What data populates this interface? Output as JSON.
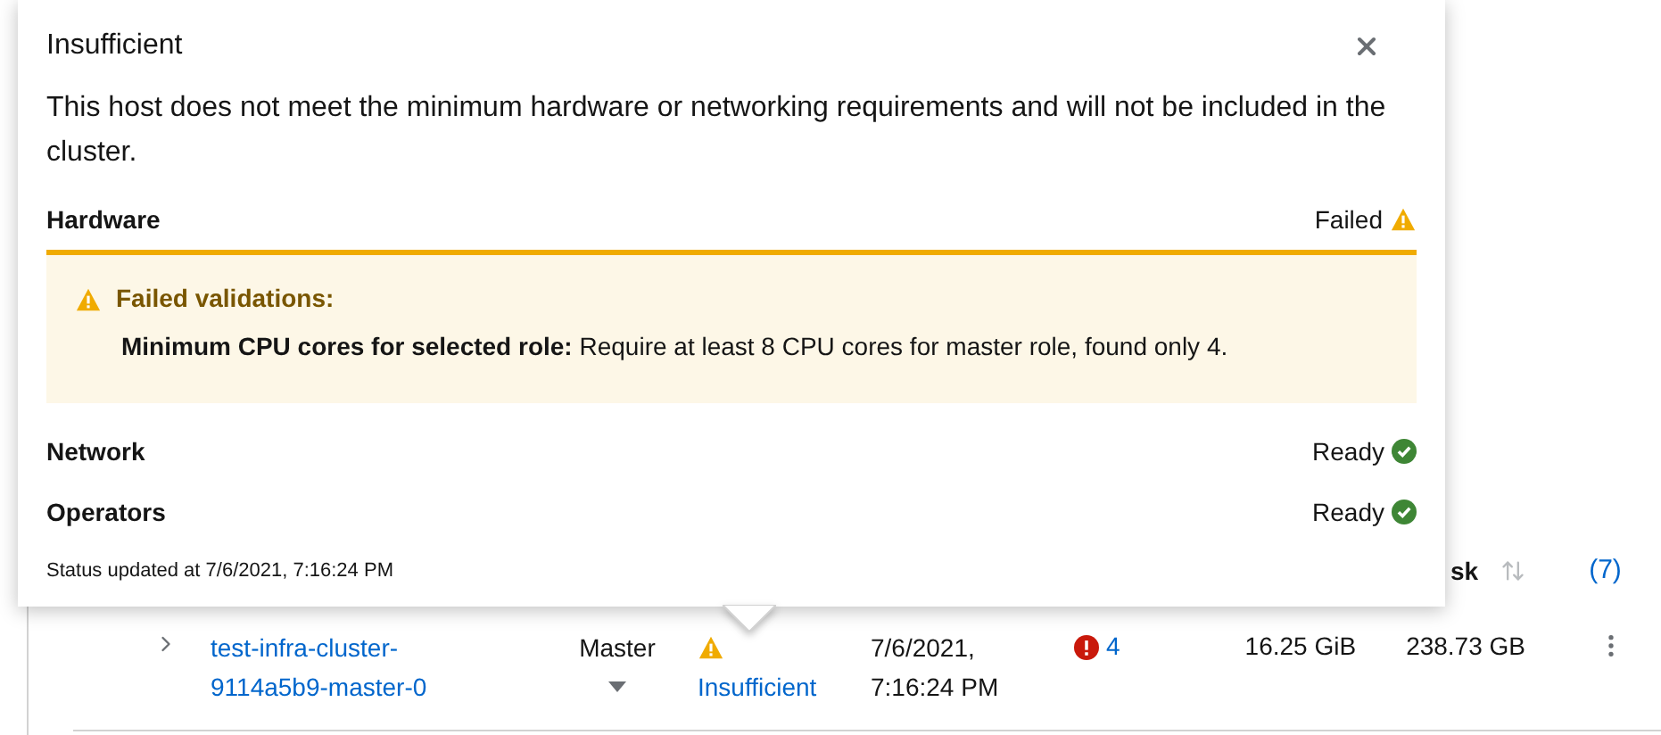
{
  "popover": {
    "title": "Insufficient",
    "description": "This host does not meet the minimum hardware or networking requirements and will not be included in the cluster.",
    "sections": [
      {
        "label": "Hardware",
        "status": "Failed",
        "kind": "failed",
        "alert": {
          "title": "Failed validations:",
          "items": [
            {
              "name": "Minimum CPU cores for selected role:",
              "text": "Require at least 8 CPU cores for master role, found only 4."
            }
          ]
        }
      },
      {
        "label": "Network",
        "status": "Ready",
        "kind": "ready"
      },
      {
        "label": "Operators",
        "status": "Ready",
        "kind": "ready"
      }
    ],
    "footer": "Status updated at 7/6/2021, 7:16:24 PM"
  },
  "table": {
    "header": {
      "column": "sk",
      "count": "(7)"
    },
    "rows": [
      {
        "name": "test-infra-cluster-9114a5b9-master-0",
        "role": "Master",
        "status": "Insufficient",
        "kind": "warning",
        "updated": "7/6/2021, 7:16:24 PM",
        "alerts": "4",
        "memory": "16.25 GiB",
        "disk": "238.73 GB"
      }
    ]
  }
}
